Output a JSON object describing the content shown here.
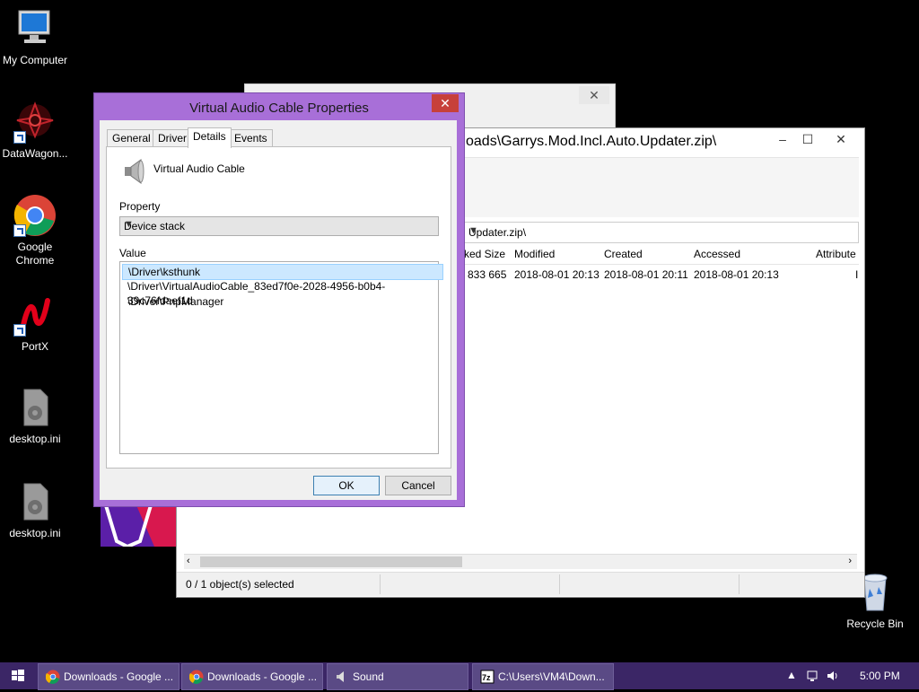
{
  "desktop": {
    "icons": [
      {
        "label": "My Computer",
        "icon": "computer-icon"
      },
      {
        "label": "DataWagon...",
        "icon": "datawagon-icon"
      },
      {
        "label": "Google Chrome",
        "icon": "chrome-icon"
      },
      {
        "label": "PortX",
        "icon": "portx-icon"
      },
      {
        "label": "desktop.ini",
        "icon": "config-file-icon"
      },
      {
        "label": "desktop.ini",
        "icon": "config-file-icon"
      },
      {
        "label": "Recycle Bin",
        "icon": "recycle-bin-icon"
      }
    ]
  },
  "zip_window": {
    "title": "oads\\Garrys.Mod.Incl.Auto.Updater.zip\\",
    "address": "Updater.zip\\",
    "columns": [
      "ked Size",
      "Modified",
      "Created",
      "Accessed",
      "Attribute"
    ],
    "row": {
      "packed": "833 665",
      "modified": "2018-08-01 20:13",
      "created": "2018-08-01 20:11",
      "accessed": "2018-08-01 20:13",
      "attr": "I"
    },
    "status": "0 / 1 object(s) selected"
  },
  "properties": {
    "title": "Virtual Audio Cable Properties",
    "tabs": [
      "General",
      "Driver",
      "Details",
      "Events"
    ],
    "active_tab": "Details",
    "device_name": "Virtual Audio Cable",
    "property_label": "Property",
    "property_value": "Device stack",
    "value_label": "Value",
    "values": [
      "\\Driver\\ksthunk",
      "\\Driver\\VirtualAudioCable_83ed7f0e-2028-4956-b0b4-39c76fdaef1d",
      "\\Driver\\PnpManager"
    ],
    "ok_label": "OK",
    "cancel_label": "Cancel"
  },
  "taskbar": {
    "items": [
      {
        "label": "Downloads - Google ...",
        "icon": "chrome-icon"
      },
      {
        "label": "Downloads - Google ...",
        "icon": "chrome-icon"
      },
      {
        "label": "Sound",
        "icon": "speaker-icon"
      },
      {
        "label": "C:\\Users\\VM4\\Down...",
        "icon": "7zip-icon"
      }
    ],
    "clock": "5:00 PM"
  },
  "colors": {
    "dialog_frame": "#a86fd8",
    "taskbar": "#3b2666",
    "selection": "#cce8ff"
  }
}
